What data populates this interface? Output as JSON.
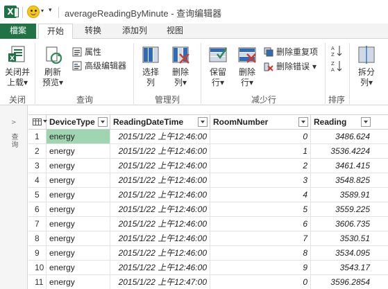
{
  "window": {
    "title": "averageReadingByMinute - 查询编辑器"
  },
  "tabs": [
    "檔案",
    "开始",
    "转换",
    "添加列",
    "视图"
  ],
  "ribbon": {
    "close_group": {
      "btn1": "关闭并",
      "btn2": "上载",
      "dd": "▾",
      "label": "关闭"
    },
    "query_group": {
      "refresh1": "刷新",
      "refresh2": "预览",
      "dd": "▾",
      "properties": "属性",
      "advanced_editor": "高级编辑器",
      "label": "查询"
    },
    "manage_cols_group": {
      "choose1": "选择",
      "choose2": "列",
      "remove1": "删除",
      "remove2": "列",
      "dd": "▾",
      "label": "管理列"
    },
    "reduce_rows_group": {
      "keep1": "保留",
      "keep2": "行",
      "remove1": "删除",
      "remove2": "行",
      "dd": "▾",
      "remove_duplicates": "删除重复项",
      "remove_errors": "删除错误",
      "label": "减少行"
    },
    "sort_group": {
      "label": "排序"
    },
    "split_group": {
      "split1": "拆分",
      "split2": "列",
      "label": ""
    }
  },
  "left_pane": {
    "label": "查询"
  },
  "grid": {
    "columns": [
      "DeviceType",
      "ReadingDateTime",
      "RoomNumber",
      "Reading"
    ],
    "rows": [
      [
        "1",
        "energy",
        "2015/1/22 上午12:46:00",
        "0",
        "3486.624"
      ],
      [
        "2",
        "energy",
        "2015/1/22 上午12:46:00",
        "1",
        "3536.4224"
      ],
      [
        "3",
        "energy",
        "2015/1/22 上午12:46:00",
        "2",
        "3461.415"
      ],
      [
        "4",
        "energy",
        "2015/1/22 上午12:46:00",
        "3",
        "3548.825"
      ],
      [
        "5",
        "energy",
        "2015/1/22 上午12:46:00",
        "4",
        "3589.91"
      ],
      [
        "6",
        "energy",
        "2015/1/22 上午12:46:00",
        "5",
        "3559.225"
      ],
      [
        "7",
        "energy",
        "2015/1/22 上午12:46:00",
        "6",
        "3606.735"
      ],
      [
        "8",
        "energy",
        "2015/1/22 上午12:46:00",
        "7",
        "3530.51"
      ],
      [
        "9",
        "energy",
        "2015/1/22 上午12:46:00",
        "8",
        "3534.095"
      ],
      [
        "10",
        "energy",
        "2015/1/22 上午12:46:00",
        "9",
        "3543.17"
      ],
      [
        "11",
        "energy",
        "2015/1/22 上午12:47:00",
        "0",
        "3596.2854"
      ]
    ]
  },
  "colors": {
    "excel_green": "#217346",
    "selected_cell": "#9fd5b1"
  }
}
